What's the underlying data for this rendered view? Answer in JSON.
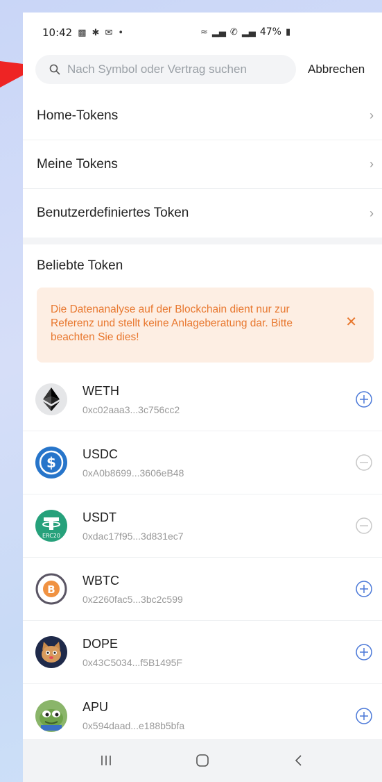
{
  "status_bar": {
    "time": "10:42",
    "dot": "•",
    "battery": "47%",
    "icons": [
      "gallery-icon",
      "walk-icon",
      "message-icon",
      "wifi-icon",
      "signal-icon",
      "call-icon",
      "battery-icon"
    ]
  },
  "search": {
    "placeholder": "Nach Symbol oder Vertrag suchen",
    "cancel_label": "Abbrechen"
  },
  "nav": [
    {
      "label": "Home-Tokens"
    },
    {
      "label": "Meine Tokens"
    },
    {
      "label": "Benutzerdefiniertes Token"
    }
  ],
  "popular": {
    "title": "Beliebte Token",
    "notice": "Die Datenanalyse auf der Blockchain dient nur zur Referenz und stellt keine Anlageberatung dar. Bitte beachten Sie dies!",
    "tokens": [
      {
        "symbol": "WETH",
        "address": "0xc02aaa3...3c756cc2",
        "action": "add"
      },
      {
        "symbol": "USDC",
        "address": "0xA0b8699...3606eB48",
        "action": "remove"
      },
      {
        "symbol": "USDT",
        "address": "0xdac17f95...3d831ec7",
        "action": "remove"
      },
      {
        "symbol": "WBTC",
        "address": "0x2260fac5...3bc2c599",
        "action": "add"
      },
      {
        "symbol": "DOPE",
        "address": "0x43C5034...f5B1495F",
        "action": "add"
      },
      {
        "symbol": "APU",
        "address": "0x594daad...e188b5bfa",
        "action": "add"
      }
    ]
  },
  "colors": {
    "accent": "#4a78d8",
    "notice_bg": "#fdeee3",
    "notice_text": "#e8772e",
    "arrow": "#ee2424"
  }
}
